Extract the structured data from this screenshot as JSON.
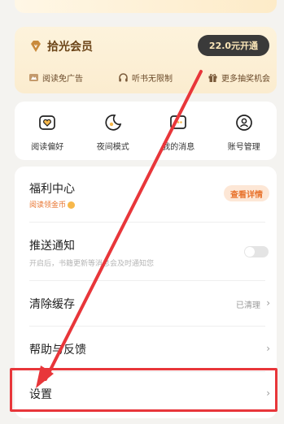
{
  "vip": {
    "title": "拾光会员",
    "open_button": "22.0元开通",
    "perks": [
      {
        "icon": "ad-free-icon",
        "label": "阅读免广告"
      },
      {
        "icon": "headphones-icon",
        "label": "听书无限制"
      },
      {
        "icon": "gift-icon",
        "label": "更多抽奖机会"
      }
    ]
  },
  "tools": [
    {
      "icon": "heart-book-icon",
      "label": "阅读偏好"
    },
    {
      "icon": "moon-icon",
      "label": "夜间模式"
    },
    {
      "icon": "message-icon",
      "label": "我的消息"
    },
    {
      "icon": "account-icon",
      "label": "账号管理"
    }
  ],
  "list": {
    "welfare": {
      "title": "福利中心",
      "sub": "阅读领金币",
      "badge": "查看详情"
    },
    "push": {
      "title": "推送通知",
      "sub": "开启后，书籍更新等消息会及时通知您",
      "enabled": false
    },
    "cache": {
      "title": "清除缓存",
      "status": "已清理"
    },
    "help": {
      "title": "帮助与反馈"
    },
    "settings": {
      "title": "设置"
    }
  },
  "colors": {
    "accent": "#e8742f",
    "highlight": "#e8363a",
    "vip_text": "#6b4417"
  }
}
